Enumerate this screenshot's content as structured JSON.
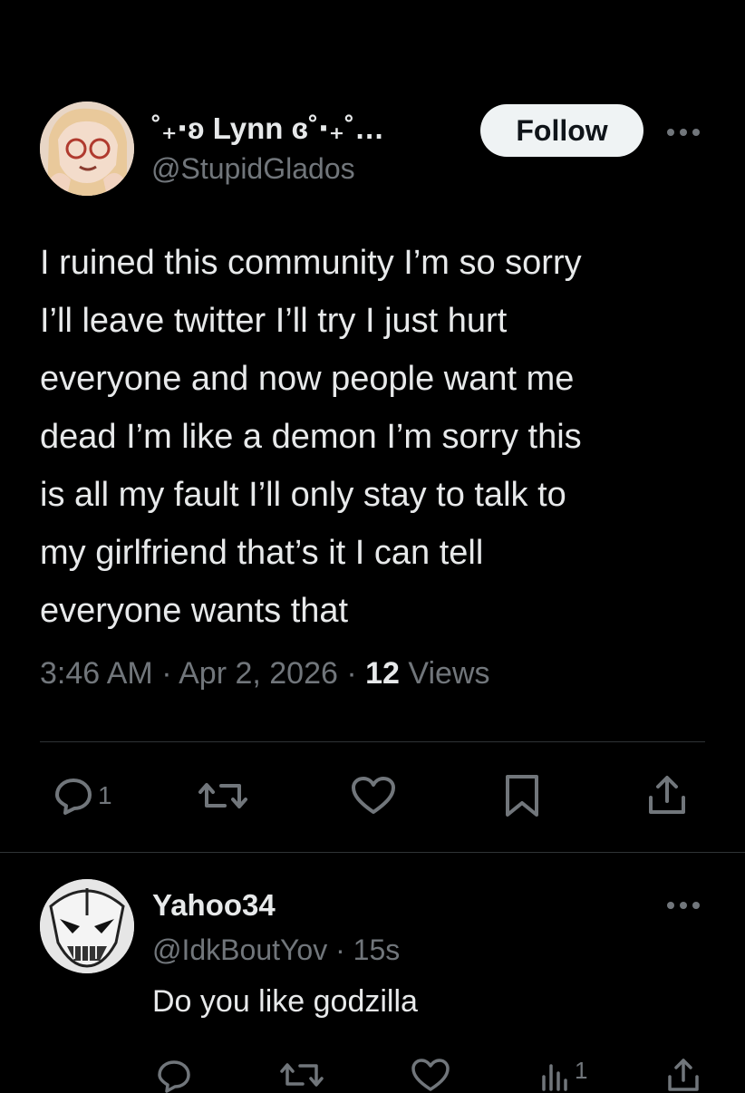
{
  "tweet": {
    "display_name": "˚₊‧ʚ Lynn ɞ˚‧₊˚…",
    "handle": "@StupidGlados",
    "follow_label": "Follow",
    "text_lines": [
      "I ruined this community I’m so sorry",
      "I’ll leave twitter I’ll try I just hurt",
      "everyone and now people want me",
      "dead I’m like a demon I’m sorry this",
      "is all my fault I’ll only stay to talk to",
      "my girlfriend that’s it I can tell",
      "everyone wants that"
    ],
    "time": "3:46 AM",
    "date": "Apr 2, 2026",
    "views_count": "12",
    "views_label": "Views",
    "separator": "·",
    "actions": {
      "reply_count": "1",
      "reply_icon": "reply-icon",
      "repost_icon": "repost-icon",
      "like_icon": "heart-icon",
      "bookmark_icon": "bookmark-icon",
      "share_icon": "share-icon"
    }
  },
  "reply": {
    "display_name": "Yahoo34",
    "handle": "@IdkBoutYov",
    "time": "15s",
    "separator": "·",
    "text": "Do you like godzilla",
    "views_count": "1"
  },
  "colors": {
    "background": "#000000",
    "primary_text": "#e7e9ea",
    "secondary_text": "#71767b",
    "divider": "#2f3336",
    "follow_bg": "#eff3f4"
  }
}
